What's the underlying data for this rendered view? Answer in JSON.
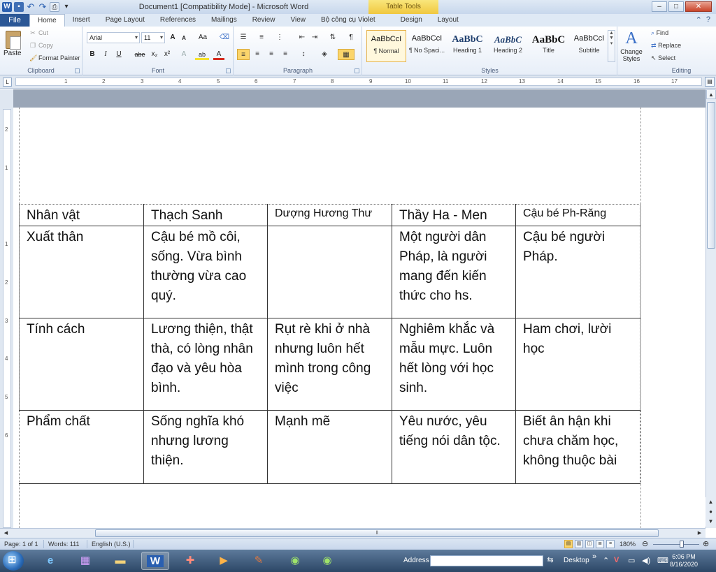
{
  "window": {
    "title": "Document1 [Compatibility Mode] - Microsoft Word",
    "contextual_tab_group": "Table Tools",
    "quick_access": [
      "W",
      "save",
      "↶",
      "↷",
      "print",
      "▾"
    ],
    "controls": [
      "–",
      "□",
      "✕"
    ]
  },
  "tabs": [
    {
      "label": "File"
    },
    {
      "label": "Home"
    },
    {
      "label": "Insert"
    },
    {
      "label": "Page Layout"
    },
    {
      "label": "References"
    },
    {
      "label": "Mailings"
    },
    {
      "label": "Review"
    },
    {
      "label": "View"
    },
    {
      "label": "Bộ công cụ Violet"
    },
    {
      "label": "Design"
    },
    {
      "label": "Layout"
    }
  ],
  "ribbon_controls": [
    "⌃",
    "?"
  ],
  "clipboard": {
    "paste": "Paste",
    "cut": "Cut",
    "copy": "Copy",
    "format_painter": "Format Painter",
    "label": "Clipboard"
  },
  "font": {
    "family": "Arial",
    "size": "11",
    "label": "Font",
    "buttons": [
      "A",
      "A",
      "Aa",
      "B",
      "I",
      "U",
      "abe",
      "x₂",
      "x²",
      "A",
      "ab",
      "A"
    ]
  },
  "paragraph": {
    "label": "Paragraph"
  },
  "styles": {
    "label": "Styles",
    "items": [
      {
        "sample": "AaBbCcI",
        "name": "¶ Normal"
      },
      {
        "sample": "AaBbCcI",
        "name": "¶ No Spaci..."
      },
      {
        "sample": "AaBbC",
        "name": "Heading 1"
      },
      {
        "sample": "AaBbC",
        "name": "Heading 2"
      },
      {
        "sample": "AaBbC",
        "name": "Title"
      },
      {
        "sample": "AaBbCcI",
        "name": "Subtitle"
      }
    ],
    "change_styles": "Change Styles"
  },
  "editing": {
    "find": "Find",
    "replace": "Replace",
    "select": "Select",
    "label": "Editing"
  },
  "ruler": {
    "numbers": [
      "1",
      "2",
      "3",
      "4",
      "5",
      "6",
      "7",
      "8",
      "9",
      "10",
      "11",
      "12",
      "13",
      "14",
      "15",
      "16",
      "17"
    ],
    "vertical_numbers": [
      "2",
      "1",
      "1",
      "2",
      "3",
      "4",
      "5",
      "6"
    ]
  },
  "table": {
    "rows": [
      [
        "Nhân vật",
        "Thạch Sanh",
        "Dượng Hương Thư",
        "Thầy Ha - Men",
        "Cậu bé Ph-Răng"
      ],
      [
        "Xuất thân",
        "Cậu bé mồ côi, sống. Vừa bình thường vừa cao quý.",
        "",
        "Một người dân Pháp, là người mang đến kiến thức cho hs.",
        "Cậu bé người Pháp."
      ],
      [
        "Tính cách",
        "Lương thiện, thật thà, có lòng nhân đạo và yêu hòa bình.",
        "Rụt rè khi ở nhà nhưng luôn hết mình trong công việc",
        "Nghiêm khắc và mẫu mực. Luôn hết lòng với học sinh.",
        "Ham chơi, lười học"
      ],
      [
        "Phẩm chất",
        "Sống nghĩa khó nhưng lương thiện.",
        "Mạnh mẽ",
        "Yêu nước, yêu tiếng nói dân tộc.",
        "Biết ân hận khi chưa chăm học, không thuộc bài"
      ]
    ]
  },
  "status": {
    "page": "Page: 1 of 1",
    "words": "Words: 111",
    "language": "English (U.S.)",
    "zoom": "180%",
    "zoom_value": 1.8
  },
  "taskbar": {
    "address_label": "Address",
    "address_value": "",
    "desktop_label": "Desktop",
    "time": "6:06 PM",
    "date": "8/16/2020"
  }
}
